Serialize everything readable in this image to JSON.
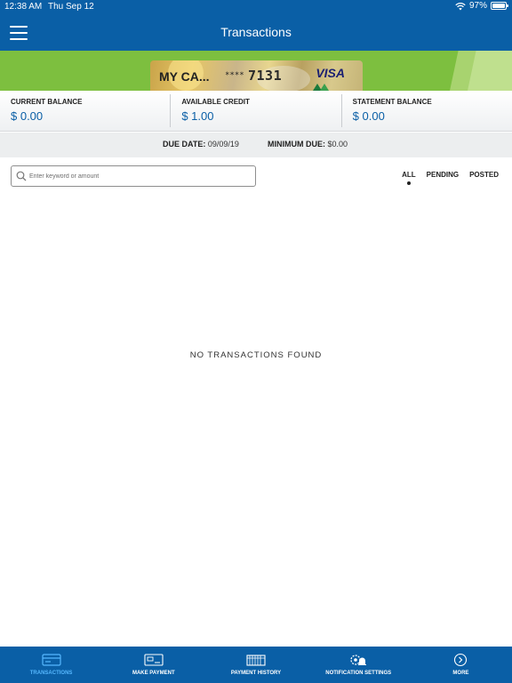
{
  "status_bar": {
    "time": "12:38 AM",
    "date": "Thu Sep 12",
    "battery_percent": "97%",
    "battery_level": 0.97
  },
  "nav": {
    "title": "Transactions",
    "menu_icon": "hamburger-menu-icon"
  },
  "card": {
    "name": "MY CA...",
    "masked": "****",
    "last4": "7131",
    "brand": "VISA"
  },
  "colors": {
    "primary": "#0a5fa6",
    "banner_green": "#7dbf3f",
    "active_tab": "#56b8ff"
  },
  "balances": [
    {
      "label": "CURRENT BALANCE",
      "value": "$ 0.00"
    },
    {
      "label": "AVAILABLE CREDIT",
      "value": "$ 1.00"
    },
    {
      "label": "STATEMENT BALANCE",
      "value": "$ 0.00"
    }
  ],
  "due": {
    "due_date_label": "DUE DATE:",
    "due_date": "09/09/19",
    "min_due_label": "MINIMUM DUE:",
    "min_due": "$0.00"
  },
  "search": {
    "placeholder": "Enter keyword or amount",
    "value": "",
    "icon": "search-icon"
  },
  "filters": [
    {
      "label": "ALL",
      "selected": true
    },
    {
      "label": "PENDING",
      "selected": false
    },
    {
      "label": "POSTED",
      "selected": false
    }
  ],
  "empty_message": "NO TRANSACTIONS FOUND",
  "tabs": [
    {
      "label": "TRANSACTIONS",
      "icon": "transactions-icon",
      "active": true
    },
    {
      "label": "MAKE PAYMENT",
      "icon": "make-payment-icon",
      "active": false
    },
    {
      "label": "PAYMENT HISTORY",
      "icon": "payment-history-icon",
      "active": false
    },
    {
      "label": "NOTIFICATION SETTINGS",
      "icon": "notification-settings-icon",
      "active": false
    },
    {
      "label": "MORE",
      "icon": "more-icon",
      "active": false
    }
  ]
}
